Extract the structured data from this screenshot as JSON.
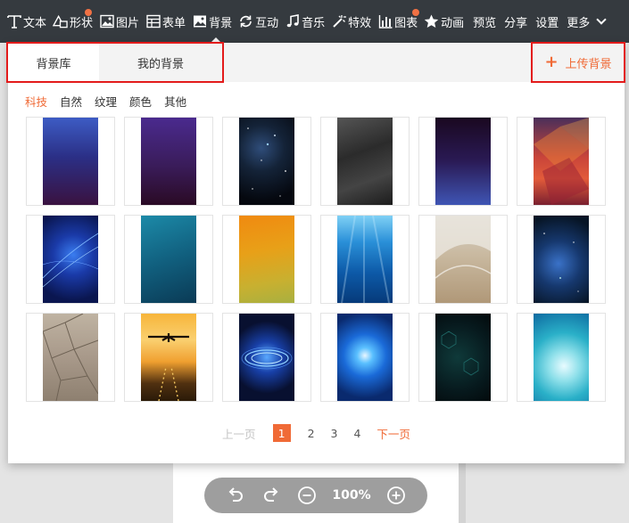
{
  "toolbar": {
    "items": [
      {
        "name": "text",
        "label": "文本",
        "icon": "text-icon"
      },
      {
        "name": "shape",
        "label": "形状",
        "icon": "shape-icon",
        "badge": true
      },
      {
        "name": "image",
        "label": "图片",
        "icon": "image-icon"
      },
      {
        "name": "form",
        "label": "表单",
        "icon": "form-icon"
      },
      {
        "name": "background",
        "label": "背景",
        "icon": "background-icon"
      },
      {
        "name": "interact",
        "label": "互动",
        "icon": "interact-icon"
      },
      {
        "name": "music",
        "label": "音乐",
        "icon": "music-icon"
      },
      {
        "name": "effects",
        "label": "特效",
        "icon": "effects-icon"
      },
      {
        "name": "chart",
        "label": "图表",
        "icon": "chart-icon",
        "badge": true
      },
      {
        "name": "animation",
        "label": "动画",
        "icon": "star-icon"
      }
    ],
    "preview": "预览",
    "share": "分享",
    "settings": "设置",
    "more": "更多"
  },
  "panel": {
    "tabs": [
      {
        "label": "背景库",
        "active": true
      },
      {
        "label": "我的背景",
        "active": false
      }
    ],
    "upload_label": "上传背景",
    "categories": [
      {
        "label": "科技",
        "active": true
      },
      {
        "label": "自然"
      },
      {
        "label": "纹理"
      },
      {
        "label": "颜色"
      },
      {
        "label": "其他"
      }
    ],
    "thumbnails": [
      {
        "desc": "blue-gradient"
      },
      {
        "desc": "purple-gradient"
      },
      {
        "desc": "starry-space"
      },
      {
        "desc": "dark-grey-smoke"
      },
      {
        "desc": "dark-purple-to-blue"
      },
      {
        "desc": "red-polygon"
      },
      {
        "desc": "blue-light-streaks"
      },
      {
        "desc": "teal-gradient"
      },
      {
        "desc": "orange-gradient"
      },
      {
        "desc": "underwater-rays"
      },
      {
        "desc": "beige-wave"
      },
      {
        "desc": "blue-nebula"
      },
      {
        "desc": "stone-tiles"
      },
      {
        "desc": "airplane-sunset"
      },
      {
        "desc": "blue-light-rings"
      },
      {
        "desc": "blue-light-burst"
      },
      {
        "desc": "dark-teal-hexagons"
      },
      {
        "desc": "teal-glow"
      }
    ],
    "pager": {
      "prev": "上一页",
      "pages": [
        "1",
        "2",
        "3",
        "4"
      ],
      "current": "1",
      "next": "下一页"
    }
  },
  "zoom_controls": {
    "zoom": "100%"
  },
  "colors": {
    "accent": "#f06a36",
    "toolbar_bg": "#353a3f",
    "highlight_box": "#e31b1b"
  }
}
